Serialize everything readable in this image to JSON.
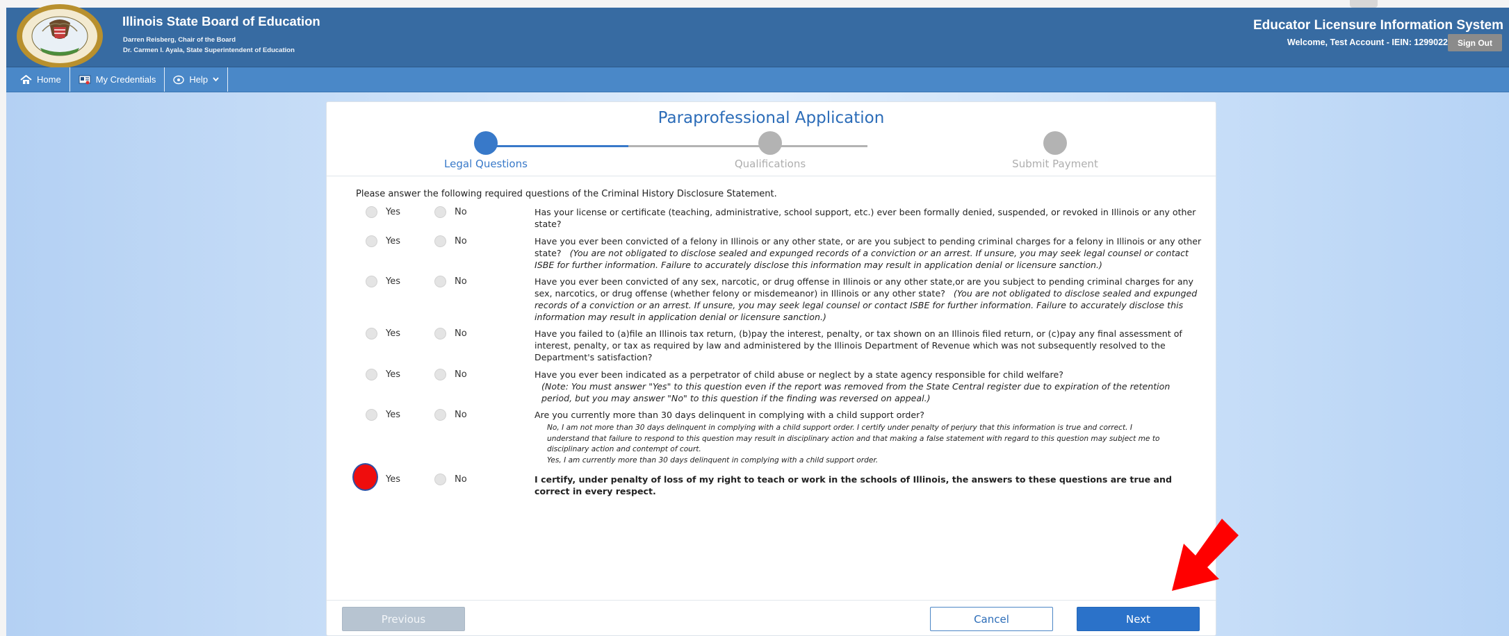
{
  "header": {
    "org_name": "Illinois State Board of Education",
    "chair_line": "Darren Reisberg, Chair of the Board",
    "superintendent_line": "Dr. Carmen I. Ayala, State Superintendent of Education",
    "system_name": "Educator Licensure Information System",
    "welcome": "Welcome, Test Account - IEIN: 1299022",
    "sign_out": "Sign Out"
  },
  "nav": {
    "home": "Home",
    "credentials": "My Credentials",
    "help": "Help"
  },
  "page": {
    "title": "Paraprofessional Application",
    "steps": [
      "Legal Questions",
      "Qualifications",
      "Submit Payment"
    ],
    "active_step_color": "#3879c9",
    "inactive_step_color": "#b3b3b3",
    "intro": "Please answer the following required questions of the Criminal History Disclosure Statement."
  },
  "options": {
    "yes": "Yes",
    "no": "No"
  },
  "questions": [
    {
      "text": "Has your license or certificate (teaching, administrative, school support, etc.) ever been formally denied, suspended, or revoked in Illinois or any other state?"
    },
    {
      "text": "Have you ever been convicted of a felony in Illinois or any other state, or are you subject to pending criminal charges for a felony in Illinois or any other state?",
      "note": "(You are not obligated to disclose sealed and expunged records of a conviction or an arrest. If unsure, you may seek legal counsel or contact ISBE for further information. Failure to accurately disclose this information may result in application denial or licensure sanction.)"
    },
    {
      "text": "Have you ever been convicted of any sex, narcotic, or drug offense in Illinois or any other state,or are you subject to pending criminal charges for any sex, narcotics, or drug offense (whether felony or misdemeanor) in Illinois or any other state?",
      "note": "(You are not obligated to disclose sealed and expunged records of a conviction or an arrest. If unsure, you may seek legal counsel or contact ISBE for further information. Failure to accurately disclose this information may result in application denial or licensure sanction.)"
    },
    {
      "text": "Have you failed to (a)file an Illinois tax return, (b)pay the interest, penalty, or tax shown on an Illinois filed return, or (c)pay any final assessment of interest, penalty, or tax as required by law and administered by the Illinois Department of Revenue which was not subsequently resolved to the Department's satisfaction?"
    },
    {
      "text": "Have you ever been indicated as a perpetrator of child abuse or neglect by a state agency responsible for child welfare?",
      "note": "(Note: You must answer \"Yes\" to this question even if the report was removed from the State Central register due to expiration of the retention period, but you may answer \"No\" to this question if the finding was reversed on appeal.)"
    },
    {
      "text": "Are you currently more than 30 days delinquent in complying with a child support order?",
      "note_lines": [
        "No, I am not more than 30 days delinquent in complying with a child support order. I certify under penalty of perjury that this information is true and correct. I understand that failure to respond to this question may result in disciplinary action and that making a false statement with regard to this question may subject me to disciplinary action and contempt of court.",
        "Yes, I am currently more than 30 days delinquent in complying with a child support order."
      ]
    },
    {
      "text": "I certify, under penalty of loss of my right to teach or work in the schools of Illinois, the answers to these questions are true and correct in every respect.",
      "bold": true
    }
  ],
  "buttons": {
    "previous": "Previous",
    "cancel": "Cancel",
    "next": "Next"
  }
}
